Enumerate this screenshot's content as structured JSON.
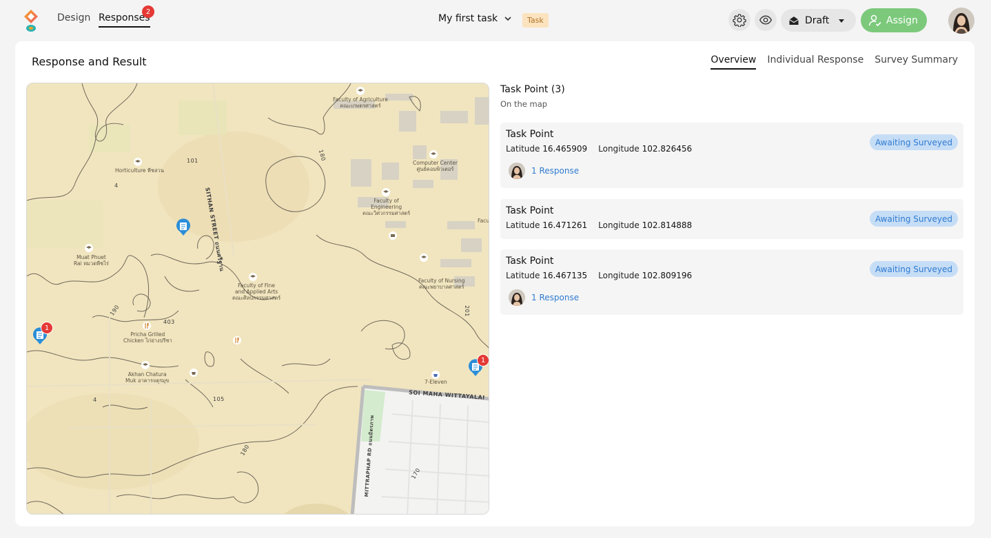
{
  "nav": {
    "design_label": "Design",
    "responses_label": "Responses",
    "responses_badge": "2"
  },
  "task": {
    "title": "My first task",
    "tag": "Task"
  },
  "actions": {
    "settings_icon": "gear-icon",
    "preview_icon": "eye-icon",
    "draft_label": "Draft",
    "assign_label": "Assign"
  },
  "colors": {
    "assign_bg": "#7cc97c",
    "status_bg": "#c6ddf6",
    "status_text": "#2f7bd0",
    "badge": "#e53935",
    "map_base": "#f0e4bd"
  },
  "card": {
    "title": "Response and Result",
    "tabs": [
      "Overview",
      "Individual Response",
      "Survey Summary"
    ]
  },
  "map": {
    "places": [
      "Faculty of Agriculture",
      "คณะเกษตรศาสตร์",
      "Computer Center",
      "ศูนย์คอมพิวเตอร์",
      "Faculty of",
      "Engineering",
      "คณะวิศวกรรมศาสตร์",
      "Horticulture พืชสวน",
      "Muat Phuet",
      "Rai หมวดพืชไร่",
      "Faculty of Fine",
      "and Applied Arts",
      "คณะศิลปกรรมศาสตร์",
      "Faculty of Nursing",
      "คณะพยาบาลศาสตร์",
      "Pricha Grilled",
      "Chicken ไก่ย่างปรีชา",
      "Akhan Chatura",
      "Muk อาคารจตุรมุข",
      "7-Eleven",
      "Facu"
    ],
    "roads": [
      "SITHAN STREET ถนนศรีฐาน",
      "SOI MAHA WITTAYALAI",
      "101",
      "4",
      "190",
      "403",
      "105",
      "180",
      "201",
      "4",
      "180",
      "170",
      "MITTRAPHAP RD ถนนมิตรภาพ"
    ],
    "marker_badges": [
      "1",
      "1"
    ]
  },
  "panel": {
    "title": "Task Point (3)",
    "subtitle": "On the map",
    "latitude_label": "Latitude",
    "longitude_label": "Longitude",
    "points": [
      {
        "title": "Task Point",
        "latitude": "16.465909",
        "longitude": "102.826456",
        "status": "Awaiting Surveyed",
        "responses": "1 Response"
      },
      {
        "title": "Task Point",
        "latitude": "16.471261",
        "longitude": "102.814888",
        "status": "Awaiting Surveyed",
        "responses": ""
      },
      {
        "title": "Task Point",
        "latitude": "16.467135",
        "longitude": "102.809196",
        "status": "Awaiting Surveyed",
        "responses": "1 Response"
      }
    ]
  }
}
